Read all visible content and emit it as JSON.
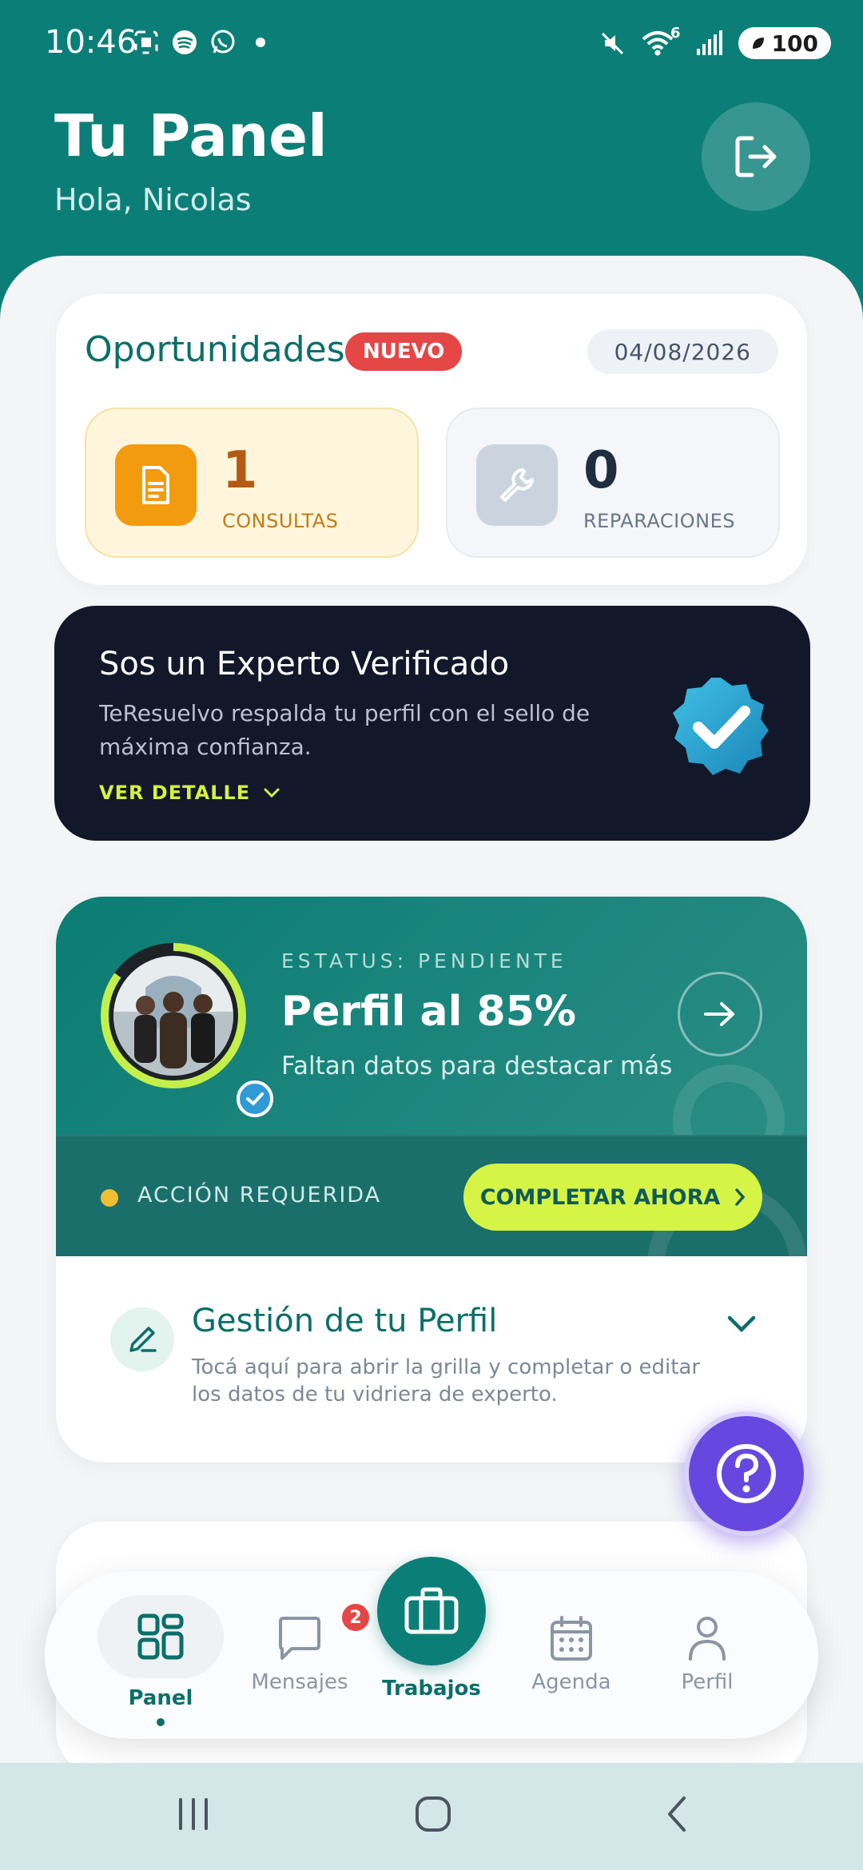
{
  "status_bar": {
    "time": "10:46",
    "network": "6",
    "battery": "100"
  },
  "header": {
    "title": "Tu Panel",
    "subtitle": "Hola, Nicolas"
  },
  "opportunities": {
    "title": "Oportunidades",
    "badge": "NUEVO",
    "date": "04/08/2026",
    "stats": [
      {
        "value": "1",
        "label": "CONSULTAS"
      },
      {
        "value": "0",
        "label": "REPARACIONES"
      }
    ]
  },
  "verified": {
    "title": "Sos un Experto Verificado",
    "description": "TeResuelvo respalda tu perfil con el sello de máxima confianza.",
    "link": "VER DETALLE"
  },
  "profile_status": {
    "status": "ESTATUS: PENDIENTE",
    "title": "Perfil al 85%",
    "progress_percent": 85,
    "subtitle": "Faltan datos para destacar más",
    "required_label": "ACCIÓN REQUERIDA",
    "cta": "COMPLETAR AHORA",
    "manage_title": "Gestión de tu Perfil",
    "manage_description": "Tocá aquí para abrir la grilla y completar o editar los datos de tu vidriera de experto."
  },
  "bottom_nav": {
    "items": [
      {
        "label": "Panel",
        "icon": "grid-icon",
        "active": true
      },
      {
        "label": "Mensajes",
        "icon": "chat-icon",
        "badge": "2"
      },
      {
        "label": "Trabajos",
        "icon": "briefcase-icon"
      },
      {
        "label": "Agenda",
        "icon": "calendar-icon"
      },
      {
        "label": "Perfil",
        "icon": "user-icon"
      }
    ]
  },
  "colors": {
    "primary": "#0b7f77",
    "accent_lime": "#d5f445",
    "badge_red": "#e54646",
    "help_purple": "#6648e0",
    "dark_card": "#12172a"
  }
}
